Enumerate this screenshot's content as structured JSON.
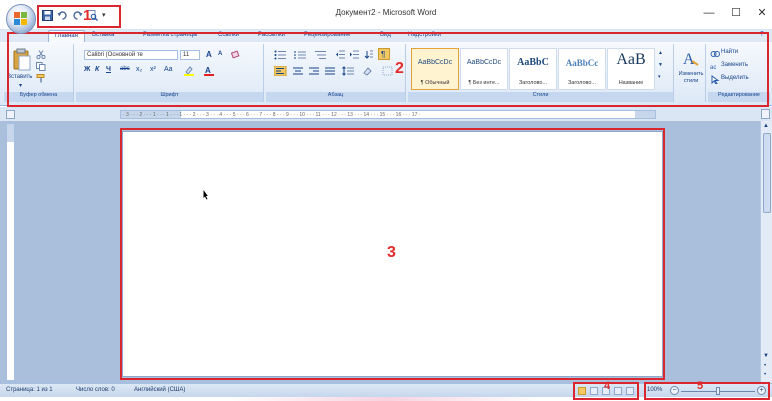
{
  "window": {
    "title": "Документ2 - Microsoft Word",
    "minimize": "—",
    "maximize": "☐",
    "close": "✕"
  },
  "qat": {
    "more": "▾"
  },
  "tabs": [
    "Главная",
    "Вставка",
    "Разметка страницы",
    "Ссылки",
    "Рассылки",
    "Рецензирование",
    "Вид",
    "Надстройки"
  ],
  "ribbon": {
    "clipboard": {
      "paste": "Вставить",
      "label": "Буфер обмена"
    },
    "font": {
      "name": "Calibri (Основной те",
      "size": "11",
      "grow": "A",
      "shrink": "A",
      "bold": "Ж",
      "italic": "К",
      "underline": "Ч",
      "strike": "abc",
      "subscript": "x₂",
      "superscript": "x²",
      "case": "Aa",
      "label": "Шрифт"
    },
    "paragraph": {
      "label": "Абзац"
    },
    "styles": {
      "items": [
        {
          "sample": "AaBbCcDc",
          "name": "¶ Обычный"
        },
        {
          "sample": "AaBbCcDc",
          "name": "¶ Без инте..."
        },
        {
          "sample": "AaBbC",
          "name": "Заголово..."
        },
        {
          "sample": "AaBbCc",
          "name": "Заголово..."
        },
        {
          "sample": "AaB",
          "name": "Название"
        }
      ],
      "change": "Изменить стили",
      "label": "Стили"
    },
    "editing": {
      "find": "Найти",
      "replace": "Заменить",
      "select": "Выделить",
      "label": "Редактирование"
    }
  },
  "ruler": {
    "text": "· 3 · · · 2 · · · 1 · · · 1 · · · 1 · · · 2 · · · 3 · · · 4 · · · 5 · · · 6 · · · 7 · · · 8 · · · 9 · · · 10 · · · 11 · · · 12 · · · 13 · · · 14 · · · 15 · · · 16 · · · 17 ·"
  },
  "status": {
    "page": "Страница: 1 из 1",
    "words": "Число слов: 0",
    "language": "Английский (США)",
    "zoom": "100%",
    "zoom_minus": "−",
    "zoom_plus": "+"
  },
  "annotations": [
    "1",
    "2",
    "3",
    "4",
    "5"
  ],
  "colors": {
    "annotation": "#d9262f",
    "ribbon": "#dce8f6",
    "workspace": "#aabfdc"
  }
}
